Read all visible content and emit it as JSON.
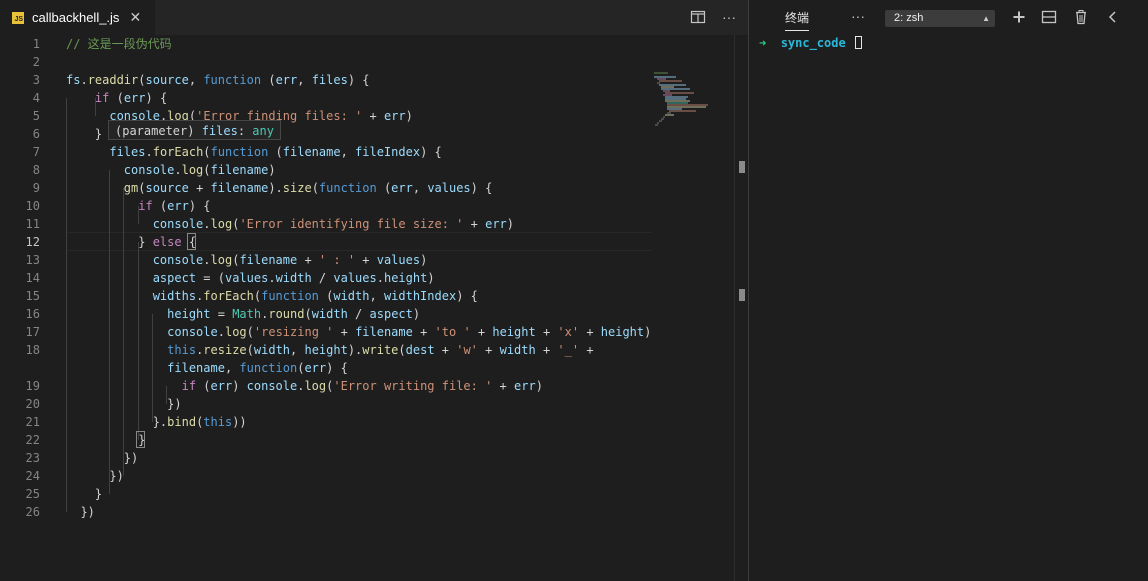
{
  "tab": {
    "filename": "callbackhell_.js",
    "lang_badge": "JS",
    "close": "✕"
  },
  "editor": {
    "more": "···",
    "hover_tooltip": [
      [
        [
          "(parameter)",
          "pn"
        ],
        [
          " files",
          "vr"
        ],
        [
          ": ",
          "pn"
        ],
        [
          "any",
          "ty"
        ]
      ]
    ],
    "lines": [
      {
        "n": "1",
        "code": [
          [
            "// 这是一段伪代码",
            "cm"
          ]
        ]
      },
      {
        "n": "2",
        "code": []
      },
      {
        "n": "3",
        "code": [
          [
            "fs",
            "vr"
          ],
          [
            ".",
            "pn"
          ],
          [
            "readdir",
            "fn"
          ],
          [
            "(",
            "pn"
          ],
          [
            "source",
            "vr"
          ],
          [
            ", ",
            "pn"
          ],
          [
            "function",
            "kw"
          ],
          [
            " (",
            "pn"
          ],
          [
            "err",
            "vr"
          ],
          [
            ", ",
            "pn"
          ],
          [
            "files",
            "vr"
          ],
          [
            ") {",
            "pn"
          ]
        ]
      },
      {
        "n": "4",
        "code": [
          [
            "    ",
            "pn"
          ],
          [
            "if",
            "ctl"
          ],
          [
            " (",
            "pn"
          ],
          [
            "err",
            "vr"
          ],
          [
            ") {",
            "pn"
          ]
        ]
      },
      {
        "n": "5",
        "code": [
          [
            "      ",
            "pn"
          ],
          [
            "console",
            "vr"
          ],
          [
            ".",
            "pn"
          ],
          [
            "log",
            "fn"
          ],
          [
            "(",
            "pn"
          ],
          [
            "'Error finding files: '",
            "st"
          ],
          [
            " + ",
            "pn"
          ],
          [
            "err",
            "vr"
          ],
          [
            ")",
            "pn"
          ]
        ]
      },
      {
        "n": "6",
        "code": [
          [
            "    }",
            "pn"
          ]
        ]
      },
      {
        "n": "7",
        "code": [
          [
            "      ",
            "pn"
          ],
          [
            "files",
            "vr"
          ],
          [
            ".",
            "pn"
          ],
          [
            "forEach",
            "fn"
          ],
          [
            "(",
            "pn"
          ],
          [
            "function",
            "kw"
          ],
          [
            " (",
            "pn"
          ],
          [
            "filename",
            "vr"
          ],
          [
            ", ",
            "pn"
          ],
          [
            "fileIndex",
            "vr"
          ],
          [
            ") {",
            "pn"
          ]
        ]
      },
      {
        "n": "8",
        "code": [
          [
            "        ",
            "pn"
          ],
          [
            "console",
            "vr"
          ],
          [
            ".",
            "pn"
          ],
          [
            "log",
            "fn"
          ],
          [
            "(",
            "pn"
          ],
          [
            "filename",
            "vr"
          ],
          [
            ")",
            "pn"
          ]
        ]
      },
      {
        "n": "9",
        "code": [
          [
            "        ",
            "pn"
          ],
          [
            "gm",
            "fn"
          ],
          [
            "(",
            "pn"
          ],
          [
            "source",
            "vr"
          ],
          [
            " + ",
            "pn"
          ],
          [
            "filename",
            "vr"
          ],
          [
            ").",
            "pn"
          ],
          [
            "size",
            "fn"
          ],
          [
            "(",
            "pn"
          ],
          [
            "function",
            "kw"
          ],
          [
            " (",
            "pn"
          ],
          [
            "err",
            "vr"
          ],
          [
            ", ",
            "pn"
          ],
          [
            "values",
            "vr"
          ],
          [
            ") {",
            "pn"
          ]
        ]
      },
      {
        "n": "10",
        "code": [
          [
            "          ",
            "pn"
          ],
          [
            "if",
            "ctl"
          ],
          [
            " (",
            "pn"
          ],
          [
            "err",
            "vr"
          ],
          [
            ") {",
            "pn"
          ]
        ]
      },
      {
        "n": "11",
        "code": [
          [
            "            ",
            "pn"
          ],
          [
            "console",
            "vr"
          ],
          [
            ".",
            "pn"
          ],
          [
            "log",
            "fn"
          ],
          [
            "(",
            "pn"
          ],
          [
            "'Error identifying file size: '",
            "st"
          ],
          [
            " + ",
            "pn"
          ],
          [
            "err",
            "vr"
          ],
          [
            ")",
            "pn"
          ]
        ]
      },
      {
        "n": "12",
        "active": true,
        "code": [
          [
            "          } ",
            "pn"
          ],
          [
            "else",
            "ctl"
          ],
          [
            " {",
            "pn"
          ]
        ]
      },
      {
        "n": "13",
        "code": [
          [
            "            ",
            "pn"
          ],
          [
            "console",
            "vr"
          ],
          [
            ".",
            "pn"
          ],
          [
            "log",
            "fn"
          ],
          [
            "(",
            "pn"
          ],
          [
            "filename",
            "vr"
          ],
          [
            " + ",
            "pn"
          ],
          [
            "' : '",
            "st"
          ],
          [
            " + ",
            "pn"
          ],
          [
            "values",
            "vr"
          ],
          [
            ")",
            "pn"
          ]
        ]
      },
      {
        "n": "14",
        "code": [
          [
            "            ",
            "pn"
          ],
          [
            "aspect",
            "vr"
          ],
          [
            " = (",
            "pn"
          ],
          [
            "values",
            "vr"
          ],
          [
            ".",
            "pn"
          ],
          [
            "width",
            "vr"
          ],
          [
            " / ",
            "pn"
          ],
          [
            "values",
            "vr"
          ],
          [
            ".",
            "pn"
          ],
          [
            "height",
            "vr"
          ],
          [
            ")",
            "pn"
          ]
        ]
      },
      {
        "n": "15",
        "code": [
          [
            "            ",
            "pn"
          ],
          [
            "widths",
            "vr"
          ],
          [
            ".",
            "pn"
          ],
          [
            "forEach",
            "fn"
          ],
          [
            "(",
            "pn"
          ],
          [
            "function",
            "kw"
          ],
          [
            " (",
            "pn"
          ],
          [
            "width",
            "vr"
          ],
          [
            ", ",
            "pn"
          ],
          [
            "widthIndex",
            "vr"
          ],
          [
            ") {",
            "pn"
          ]
        ]
      },
      {
        "n": "16",
        "code": [
          [
            "              ",
            "pn"
          ],
          [
            "height",
            "vr"
          ],
          [
            " = ",
            "pn"
          ],
          [
            "Math",
            "ty"
          ],
          [
            ".",
            "pn"
          ],
          [
            "round",
            "fn"
          ],
          [
            "(",
            "pn"
          ],
          [
            "width",
            "vr"
          ],
          [
            " / ",
            "pn"
          ],
          [
            "aspect",
            "vr"
          ],
          [
            ")",
            "pn"
          ]
        ]
      },
      {
        "n": "17",
        "code": [
          [
            "              ",
            "pn"
          ],
          [
            "console",
            "vr"
          ],
          [
            ".",
            "pn"
          ],
          [
            "log",
            "fn"
          ],
          [
            "(",
            "pn"
          ],
          [
            "'resizing '",
            "st"
          ],
          [
            " + ",
            "pn"
          ],
          [
            "filename",
            "vr"
          ],
          [
            " + ",
            "pn"
          ],
          [
            "'to '",
            "st"
          ],
          [
            " + ",
            "pn"
          ],
          [
            "height",
            "vr"
          ],
          [
            " + ",
            "pn"
          ],
          [
            "'x'",
            "st"
          ],
          [
            " + ",
            "pn"
          ],
          [
            "height",
            "vr"
          ],
          [
            ")",
            "pn"
          ]
        ]
      },
      {
        "n": "18",
        "code": [
          [
            "              ",
            "pn"
          ],
          [
            "this",
            "kw"
          ],
          [
            ".",
            "pn"
          ],
          [
            "resize",
            "fn"
          ],
          [
            "(",
            "pn"
          ],
          [
            "width",
            "vr"
          ],
          [
            ", ",
            "pn"
          ],
          [
            "height",
            "vr"
          ],
          [
            ").",
            "pn"
          ],
          [
            "write",
            "fn"
          ],
          [
            "(",
            "pn"
          ],
          [
            "dest",
            "vr"
          ],
          [
            " + ",
            "pn"
          ],
          [
            "'w'",
            "st"
          ],
          [
            " + ",
            "pn"
          ],
          [
            "width",
            "vr"
          ],
          [
            " + ",
            "pn"
          ],
          [
            "'_'",
            "st"
          ],
          [
            " +",
            "pn"
          ]
        ]
      },
      {
        "n": "",
        "code": [
          [
            "              ",
            "pn"
          ],
          [
            "filename",
            "vr"
          ],
          [
            ", ",
            "pn"
          ],
          [
            "function",
            "kw"
          ],
          [
            "(",
            "pn"
          ],
          [
            "err",
            "vr"
          ],
          [
            ") {",
            "pn"
          ]
        ]
      },
      {
        "n": "19",
        "code": [
          [
            "                ",
            "pn"
          ],
          [
            "if",
            "ctl"
          ],
          [
            " (",
            "pn"
          ],
          [
            "err",
            "vr"
          ],
          [
            ") ",
            "pn"
          ],
          [
            "console",
            "vr"
          ],
          [
            ".",
            "pn"
          ],
          [
            "log",
            "fn"
          ],
          [
            "(",
            "pn"
          ],
          [
            "'Error writing file: '",
            "st"
          ],
          [
            " + ",
            "pn"
          ],
          [
            "err",
            "vr"
          ],
          [
            ")",
            "pn"
          ]
        ]
      },
      {
        "n": "20",
        "code": [
          [
            "              })",
            "pn"
          ]
        ]
      },
      {
        "n": "21",
        "code": [
          [
            "            }.",
            "pn"
          ],
          [
            "bind",
            "fn"
          ],
          [
            "(",
            "pn"
          ],
          [
            "this",
            "kw"
          ],
          [
            "))",
            "pn"
          ]
        ]
      },
      {
        "n": "22",
        "code": [
          [
            "          }",
            "pn"
          ]
        ]
      },
      {
        "n": "23",
        "code": [
          [
            "        })",
            "pn"
          ]
        ]
      },
      {
        "n": "24",
        "code": [
          [
            "      })",
            "pn"
          ]
        ]
      },
      {
        "n": "25",
        "code": [
          [
            "    }",
            "pn"
          ]
        ]
      },
      {
        "n": "26",
        "code": [
          [
            "  })",
            "pn"
          ]
        ]
      }
    ]
  },
  "terminal": {
    "title": "终端",
    "more": "···",
    "selected_shell": "2: zsh",
    "prompt_symbol": "➜",
    "cwd": "sync_code"
  },
  "colors": {
    "keyword": "#569cd6",
    "control": "#c586c0",
    "function": "#dcdcaa",
    "variable": "#9cdcfe",
    "string": "#ce9178",
    "comment": "#6a9955",
    "type": "#4ec9b0",
    "js_badge": "#e8c33a"
  },
  "icons": [
    "js-file-icon",
    "close-icon",
    "split-editor-icon",
    "more-actions-icon",
    "chevron-up-down-icon",
    "plus-icon",
    "split-terminal-icon",
    "trash-icon",
    "chevron-left-icon"
  ]
}
